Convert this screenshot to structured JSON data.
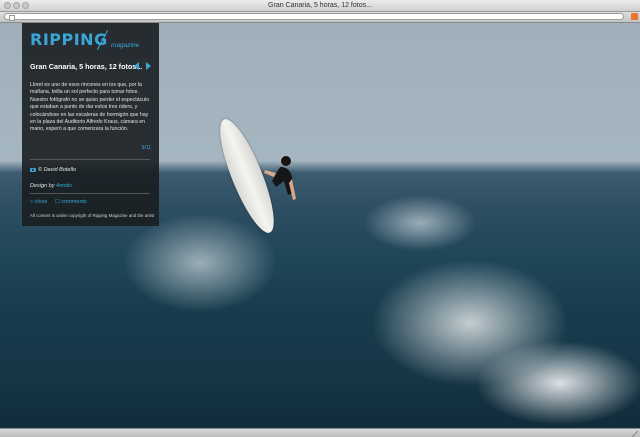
{
  "window": {
    "title": "Gran Canaria, 5 horas, 12 fotos..."
  },
  "panel": {
    "logo": "RIPPING",
    "logo_sub": "magazine",
    "headline": "Gran Canaria, 5 horas, 12 fotos...",
    "description": "Lloret es uno de esos rincones en los que, por la mañana, brilla un sol perfecto para tomar fotos. Nuestro fotógrafo no se quiso perder el espectáculo que estaban a punto de dar estos tres riders, y colocándose en las escaleras de hormigón que hay en la plaza del Auditorio Alfredo Kraus, cámara en mano, esperó a que comenzara la función.",
    "page_number": "9/11",
    "photo_credit": "© David Botello",
    "design_prefix": "Design by ",
    "design_link": "4motic",
    "close_link": "» close",
    "comments_link": "☐ comments",
    "copyright": "All content is under copyright of Ripping Magazine and the artist"
  },
  "colors": {
    "accent": "#3aa6d8",
    "panel_bg": "#1a1e20"
  }
}
